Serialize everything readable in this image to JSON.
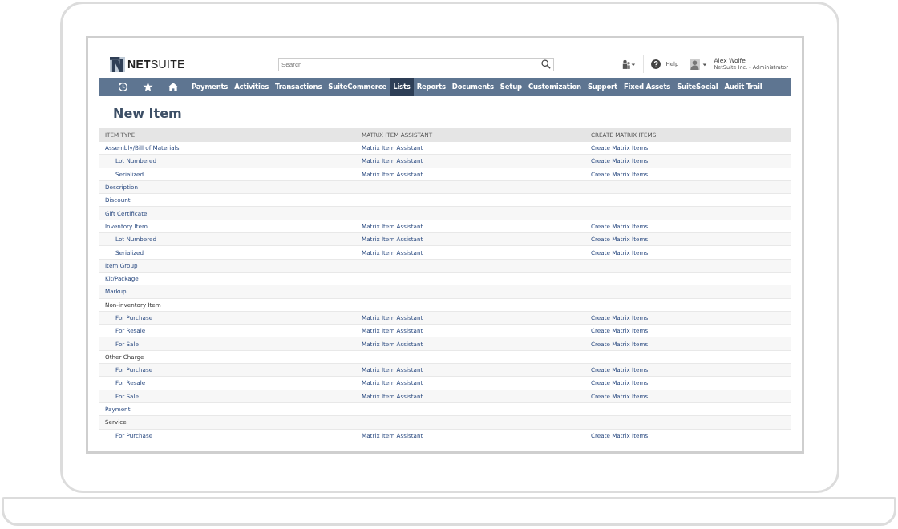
{
  "header": {
    "logo": "**NET**SUITE",
    "search": {
      "placeholder": "Search"
    },
    "help": "Help",
    "user": {
      "name": "Alex Wolfe",
      "role": "NetSuite Inc. - Administrator"
    }
  },
  "nav": [
    {
      "label": "Payments",
      "selected": false
    },
    {
      "label": "Activities",
      "selected": false
    },
    {
      "label": "Transactions",
      "selected": false
    },
    {
      "label": "SuiteCommerce",
      "selected": false
    },
    {
      "label": "Lists",
      "selected": true
    },
    {
      "label": "Reports",
      "selected": false
    },
    {
      "label": "Documents",
      "selected": false
    },
    {
      "label": "Setup",
      "selected": false
    },
    {
      "label": "Customization",
      "selected": false
    },
    {
      "label": "Support",
      "selected": false
    },
    {
      "label": "Fixed Assets",
      "selected": false
    },
    {
      "label": "SuiteSocial",
      "selected": false
    },
    {
      "label": "Audit Trail",
      "selected": false
    }
  ],
  "page_title": "New Item",
  "table": {
    "columns": [
      "ITEM TYPE",
      "MATRIX ITEM ASSISTANT",
      "CREATE MATRIX ITEMS"
    ],
    "rows": [
      {
        "item_type": "Assembly/Bill of Materials",
        "kind": "link",
        "matrix_item_assistant": "Matrix Item Assistant",
        "create_matrix_items": "Create Matrix Items",
        "children": [
          {
            "item_type": "Lot Numbered",
            "kind": "link",
            "matrix_item_assistant": "Matrix Item Assistant",
            "create_matrix_items": "Create Matrix Items"
          },
          {
            "item_type": "Serialized",
            "kind": "link",
            "matrix_item_assistant": "Matrix Item Assistant",
            "create_matrix_items": "Create Matrix Items"
          }
        ]
      },
      {
        "item_type": "Description",
        "kind": "link"
      },
      {
        "item_type": "Discount",
        "kind": "link"
      },
      {
        "item_type": "Gift Certificate",
        "kind": "link"
      },
      {
        "item_type": "Inventory Item",
        "kind": "link",
        "matrix_item_assistant": "Matrix Item Assistant",
        "create_matrix_items": "Create Matrix Items",
        "children": [
          {
            "item_type": "Lot Numbered",
            "kind": "link",
            "matrix_item_assistant": "Matrix Item Assistant",
            "create_matrix_items": "Create Matrix Items"
          },
          {
            "item_type": "Serialized",
            "kind": "link",
            "matrix_item_assistant": "Matrix Item Assistant",
            "create_matrix_items": "Create Matrix Items"
          }
        ]
      },
      {
        "item_type": "Item Group",
        "kind": "link"
      },
      {
        "item_type": "Kit/Package",
        "kind": "link"
      },
      {
        "item_type": "Markup",
        "kind": "link"
      },
      {
        "item_type": "Non-inventory Item",
        "kind": "group",
        "children": [
          {
            "item_type": "For Purchase",
            "kind": "link",
            "matrix_item_assistant": "Matrix Item Assistant",
            "create_matrix_items": "Create Matrix Items"
          },
          {
            "item_type": "For Resale",
            "kind": "link",
            "matrix_item_assistant": "Matrix Item Assistant",
            "create_matrix_items": "Create Matrix Items"
          },
          {
            "item_type": "For Sale",
            "kind": "link",
            "matrix_item_assistant": "Matrix Item Assistant",
            "create_matrix_items": "Create Matrix Items"
          }
        ]
      },
      {
        "item_type": "Other Charge",
        "kind": "group",
        "children": [
          {
            "item_type": "For Purchase",
            "kind": "link",
            "matrix_item_assistant": "Matrix Item Assistant",
            "create_matrix_items": "Create Matrix Items"
          },
          {
            "item_type": "For Resale",
            "kind": "link",
            "matrix_item_assistant": "Matrix Item Assistant",
            "create_matrix_items": "Create Matrix Items"
          },
          {
            "item_type": "For Sale",
            "kind": "link",
            "matrix_item_assistant": "Matrix Item Assistant",
            "create_matrix_items": "Create Matrix Items"
          }
        ]
      },
      {
        "item_type": "Payment",
        "kind": "link"
      },
      {
        "item_type": "Service",
        "kind": "group",
        "children": [
          {
            "item_type": "For Purchase",
            "kind": "link",
            "matrix_item_assistant": "Matrix Item Assistant",
            "create_matrix_items": "Create Matrix Items"
          }
        ]
      }
    ]
  }
}
